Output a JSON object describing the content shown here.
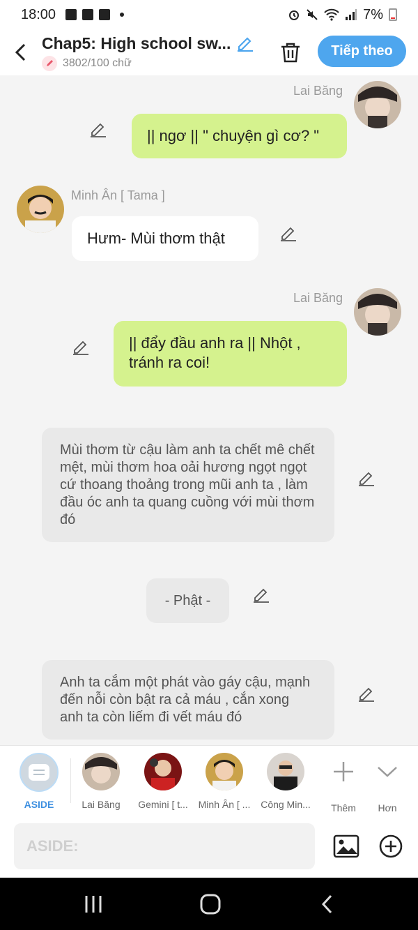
{
  "status_bar": {
    "time": "18:00",
    "battery": "7%"
  },
  "header": {
    "title": "Chap5: High school sw...",
    "word_count": "3802/100 chữ",
    "next_label": "Tiếp theo"
  },
  "messages": [
    {
      "sender": "Lai Băng",
      "text": "|| ngơ || \" chuyện gì cơ? \""
    },
    {
      "sender": "Minh Ân [ Tama ]",
      "text": "Hưm- Mùi thơm thật"
    },
    {
      "sender": "Lai Băng",
      "text": "|| đẩy đầu anh ra || Nhột , tránh ra coi!"
    },
    {
      "text": "Mùi thơm từ cậu làm anh ta chết mê chết mệt, mùi thơm hoa oải hương ngọt ngọt cứ thoang thoảng trong mũi anh ta , làm đầu óc anh ta quang cuồng với mùi thơm đó"
    },
    {
      "text": "- Phật -"
    },
    {
      "text": "Anh ta cắm một phát vào gáy cậu, mạnh đến nỗi còn bật ra cả máu , cắn xong anh ta còn liếm đi vết máu đó"
    }
  ],
  "characters": [
    {
      "label": "ASIDE"
    },
    {
      "label": "Lai Băng"
    },
    {
      "label": "Gemini [ t..."
    },
    {
      "label": "Minh Ân [ ..."
    },
    {
      "label": "Công Min..."
    },
    {
      "label": "Thêm"
    },
    {
      "label": "Hơn"
    }
  ],
  "input": {
    "placeholder": "ASIDE:"
  },
  "colors": {
    "accent": "#4ea6ee",
    "bubble_self": "#d5f28e",
    "narration": "#e9e9e9"
  }
}
